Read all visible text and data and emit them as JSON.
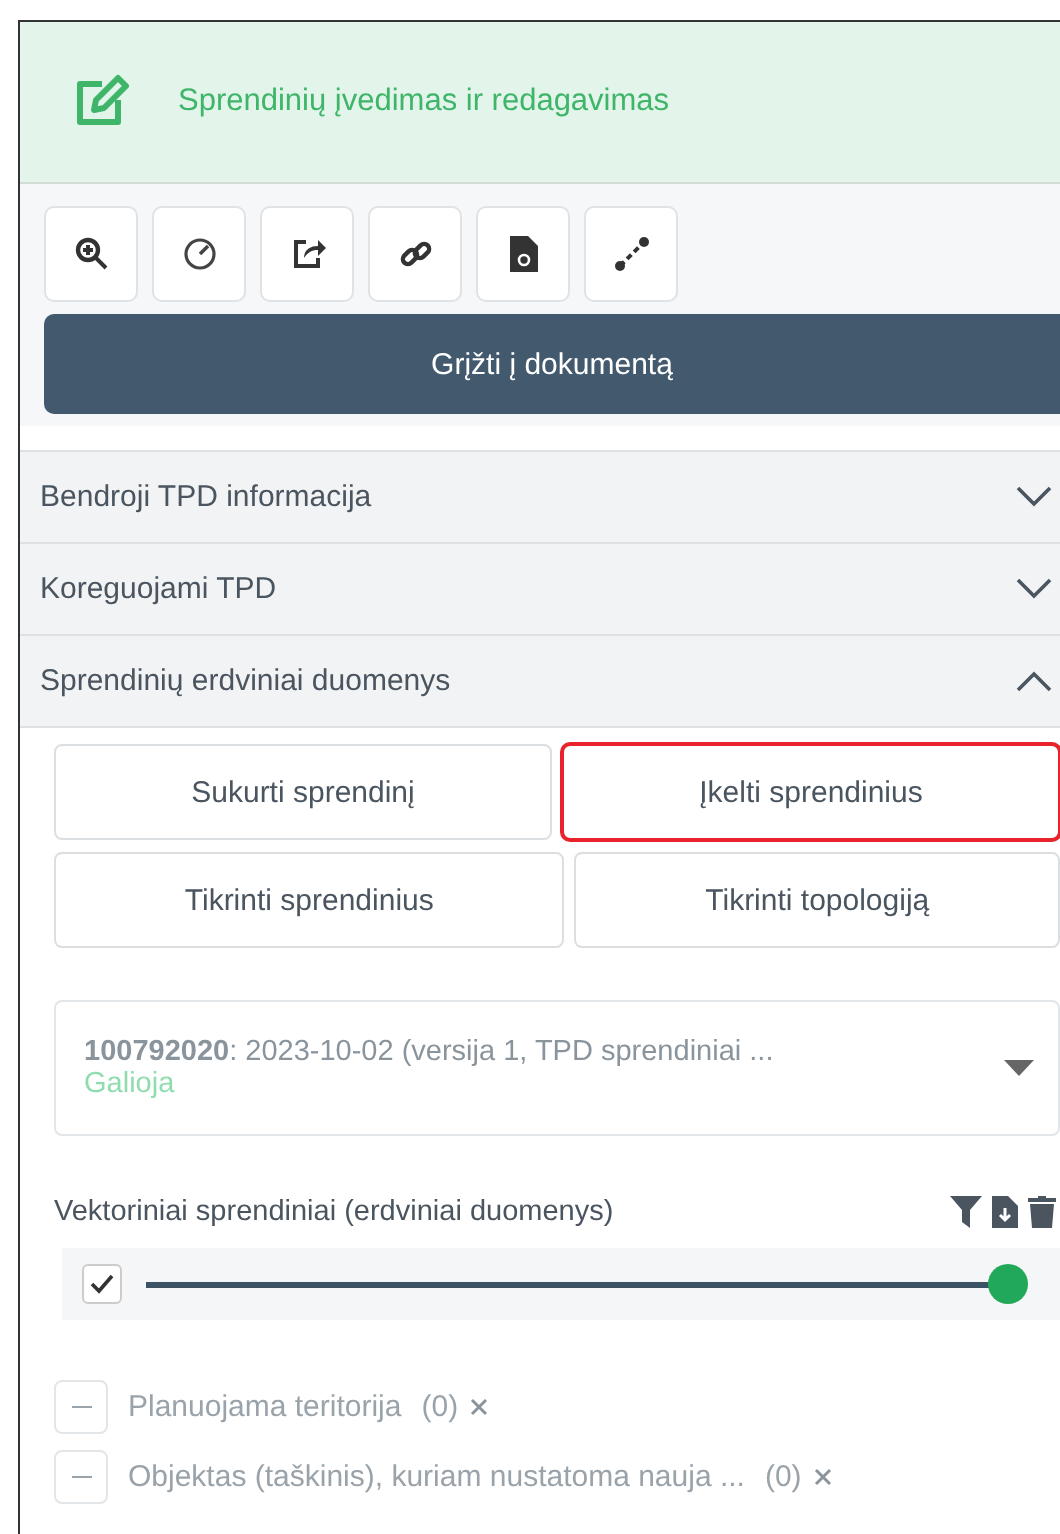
{
  "header": {
    "title": "Sprendinių įvedimas ir redagavimas"
  },
  "back_button": "Grįžti į dokumentą",
  "accordion": [
    {
      "label": "Bendroji TPD informacija",
      "expanded": false
    },
    {
      "label": "Koreguojami TPD",
      "expanded": false
    },
    {
      "label": "Sprendinių erdviniai duomenys",
      "expanded": true
    }
  ],
  "actions": [
    [
      {
        "label": "Sukurti sprendinį",
        "highlighted": false
      },
      {
        "label": "Įkelti sprendinius",
        "highlighted": true
      }
    ],
    [
      {
        "label": "Tikrinti sprendinius",
        "highlighted": false
      },
      {
        "label": "Tikrinti topologiją",
        "highlighted": false
      }
    ]
  ],
  "version_select": {
    "number": "100792020",
    "text": ": 2023-10-02 (versija 1, TPD sprendiniai ...",
    "status": "Galioja"
  },
  "layer_group": {
    "title": "Vektoriniai sprendiniai (erdviniai duomenys)",
    "checked": true,
    "level": 1,
    "layers": [
      {
        "label": "Planuojama teritorija",
        "count": "(0)"
      },
      {
        "label": "Objektas (taškinis), kuriam nustatoma nauja ...",
        "count": "(0)"
      }
    ]
  }
}
